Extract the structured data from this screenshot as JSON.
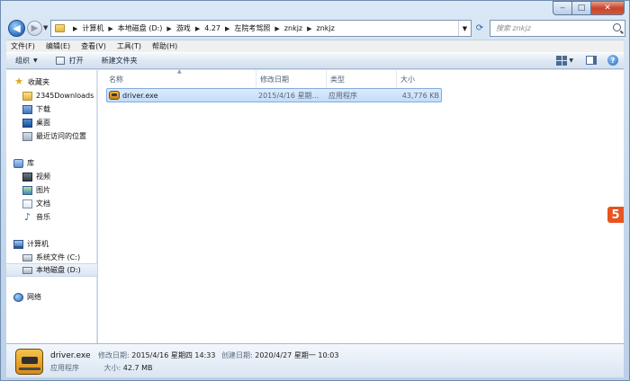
{
  "window": {
    "caption_buttons": {
      "minimize": "‒",
      "maximize": "□",
      "close": "✕"
    }
  },
  "nav": {
    "back": "◀",
    "forward": "▶",
    "breadcrumbs": [
      "计算机",
      "本地磁盘 (D:)",
      "游戏",
      "4.27",
      "左院考驾照",
      "znkjz",
      "znkjz"
    ],
    "search_placeholder": "搜索 znkjz"
  },
  "menu": [
    "文件(F)",
    "编辑(E)",
    "查看(V)",
    "工具(T)",
    "帮助(H)"
  ],
  "toolbar": {
    "organize": "组织",
    "open": "打开",
    "new_folder": "新建文件夹"
  },
  "sidebar": {
    "favorites": {
      "label": "收藏夹",
      "items": [
        "2345Downloads",
        "下载",
        "桌面",
        "最近访问的位置"
      ]
    },
    "libraries": {
      "label": "库",
      "items": [
        "视频",
        "图片",
        "文档",
        "音乐"
      ]
    },
    "computer": {
      "label": "计算机",
      "items": [
        "系统文件 (C:)",
        "本地磁盘 (D:)"
      ]
    },
    "network": {
      "label": "网络"
    }
  },
  "columns": [
    "名称",
    "修改日期",
    "类型",
    "大小"
  ],
  "files": [
    {
      "name": "driver.exe",
      "modified": "2015/4/16 星期...",
      "type": "应用程序",
      "size": "43,776 KB"
    }
  ],
  "details": {
    "name": "driver.exe",
    "modified_label": "修改日期:",
    "modified": "2015/4/16 星期四 14:33",
    "created_label": "创建日期:",
    "created": "2020/4/27 星期一 10:03",
    "type": "应用程序",
    "size_label": "大小:",
    "size": "42.7 MB"
  },
  "ime_badge": "5"
}
